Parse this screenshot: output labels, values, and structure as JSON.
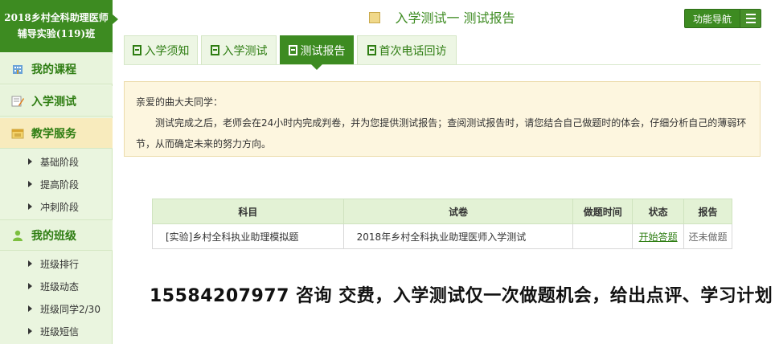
{
  "sidebar": {
    "course_title_line1": "2018乡村全科助理医师",
    "course_title_line2": "辅导实验(119)班",
    "items": [
      {
        "label": "我的课程",
        "icon": "building-icon"
      },
      {
        "label": "入学测试",
        "icon": "edit-note-icon"
      },
      {
        "label": "教学服务",
        "icon": "calendar-icon"
      },
      {
        "label": "我的班级",
        "icon": "users-icon"
      }
    ],
    "service_subitems": [
      "基础阶段",
      "提高阶段",
      "冲刺阶段"
    ],
    "class_subitems": [
      "班级排行",
      "班级动态",
      "班级同学2/30",
      "班级短信"
    ]
  },
  "header": {
    "title": "入学测试一 测试报告",
    "nav_button": "功能导航"
  },
  "tabs": [
    {
      "label": "入学须知",
      "active": false
    },
    {
      "label": "入学测试",
      "active": false
    },
    {
      "label": "测试报告",
      "active": true
    },
    {
      "label": "首次电话回访",
      "active": false
    }
  ],
  "notice": {
    "greeting": "亲爱的曲大夫同学：",
    "body": "测试完成之后，老师会在24小时内完成判卷，并为您提供测试报告；查阅测试报告时，请您结合自己做题时的体会，仔细分析自己的薄弱环节，从而确定未来的努力方向。"
  },
  "table": {
    "headers": [
      "科目",
      "试卷",
      "做题时间",
      "状态",
      "报告"
    ],
    "rows": [
      {
        "subject": "[实验]乡村全科执业助理模拟题",
        "paper": "2018年乡村全科执业助理医师入学测试",
        "time": "",
        "status": "开始答题",
        "report": "还未做题"
      }
    ]
  },
  "promo": "15584207977 咨询 交费，入学测试仅一次做题机会，给出点评、学习计划",
  "colors": {
    "brand_green": "#3d8b21",
    "notice_bg": "#fdf6df",
    "sidebar_bg": "#eaf5df"
  }
}
